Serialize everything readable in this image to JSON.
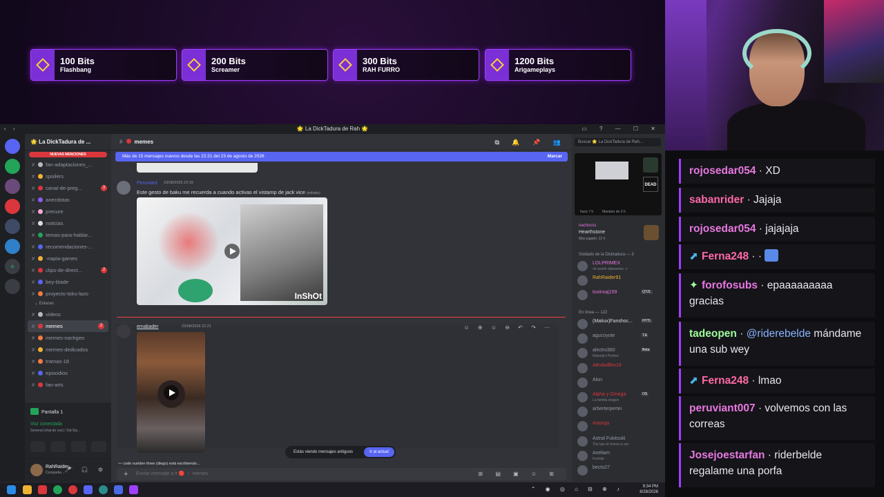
{
  "bits_goals": [
    {
      "amount": "100 Bits",
      "name": "Flashbang"
    },
    {
      "amount": "200 Bits",
      "name": "Screamer"
    },
    {
      "amount": "300 Bits",
      "name": "RAH FURRO"
    },
    {
      "amount": "1200 Bits",
      "name": "Arigameplays"
    }
  ],
  "discord": {
    "window_title": "🌟 La DickTadura de Rah 🌟",
    "server_name": "🌟 La DickTadura de ...",
    "mentions_pill": "NUEVAS MENCIONES",
    "channels": [
      {
        "name": "fan-adaptaciones_...",
        "color": "#b5bac1"
      },
      {
        "name": "spoilers",
        "color": "#f0b232"
      },
      {
        "name": "canal-de-preg...",
        "color": "#da373c",
        "badge": "3"
      },
      {
        "name": "anecdotas",
        "color": "#8a5cf6"
      },
      {
        "name": "precure",
        "color": "#f9a8d4"
      },
      {
        "name": "noticias",
        "color": "#dbdee1"
      },
      {
        "name": "temas-para-hablar...",
        "color": "#23a559"
      },
      {
        "name": "recomendaciones-...",
        "color": "#5865f2"
      },
      {
        "name": "-napia-games",
        "color": "#f0b232"
      },
      {
        "name": "clips-de-direct...",
        "color": "#da373c",
        "badge": "2"
      },
      {
        "name": "bey-blade",
        "color": "#5865f2"
      },
      {
        "name": "proyecto-toku-lazo",
        "color": "#f47b3f"
      }
    ],
    "category_label": "Enlaces",
    "channels2": [
      {
        "name": "videos",
        "color": "#b5bac1"
      },
      {
        "name": "memes",
        "color": "#da373c",
        "badge": "2",
        "active": true
      },
      {
        "name": "memes-nachgeo",
        "color": "#f47b3f"
      },
      {
        "name": "memes-dedicados",
        "color": "#f0b232"
      },
      {
        "name": "tramas-18",
        "color": "#f47b3f"
      },
      {
        "name": "episodios",
        "color": "#5865f2"
      },
      {
        "name": "fan-arts",
        "color": "#da373c"
      }
    ],
    "screen_share": "Pantalla 1",
    "voice_status": "Voz conectada",
    "voice_channel": "General (chat de voz) / Sid Sty...",
    "user_name": "RahRaider...",
    "user_status": "Compartie...",
    "channel_header": "memes",
    "new_messages_bar": "Más de 15 mensajes nuevos desde las 22:21 del 23 de agosto de 2026",
    "mark_as_read": "Marcar",
    "message1": {
      "author": "Peruviant",
      "timestamp": "23/08/2026 22:16",
      "text": "Este gesto de baku me recuerda a cuando activas el vistamp de jack vice",
      "edited": "(editado)",
      "watermark": "InShOt"
    },
    "message2": {
      "author": "emabader",
      "timestamp": "23/08/2026 22:21"
    },
    "old_messages_notice": "Estás viendo mensajes antiguos",
    "jump_button": "Ir al actual",
    "typing_text": "code number three (diego) está escribiendo...",
    "composer_placeholder": "Enviar mensaje a # 🔴 ・ memes",
    "search_placeholder": "Buscar 🌟 La DickTadura de Rah...",
    "activity": {
      "name": "nachocss",
      "game": "Hearthstone",
      "detail": "Más jugado: 12 h"
    },
    "stream_card": {
      "left": "hace 7 h",
      "right": "Maraton de 3 h"
    },
    "section_soldado": "Soldado de la Dicktadura — 3",
    "soldados": [
      {
        "name": "LOLPRIMEX",
        "sub": "oh yeahh diamantes :>",
        "color": "#e878e0"
      },
      {
        "name": "RahRaider91",
        "sub": "",
        "color": "#f0b232"
      },
      {
        "name": "toxinsaj159",
        "sub": "",
        "color": "#e878e0",
        "tag": "QTZL"
      }
    ],
    "section_online": "En línea — 122",
    "online": [
      {
        "name": "(Matiux)Fanshoc...",
        "sub": "",
        "color": "#dbdee1",
        "tag": "HYTL"
      },
      {
        "name": "agucoyote",
        "sub": "",
        "color": "#949ba4",
        "tag": "T.E"
      },
      {
        "name": "alectro360",
        "sub": "Nobody's Perfect",
        "color": "#949ba4",
        "tag": "Beta"
      },
      {
        "name": "Alexbolflex19",
        "sub": "",
        "color": "#da373c"
      },
      {
        "name": "Alon",
        "sub": "",
        "color": "#949ba4"
      },
      {
        "name": "Alpha y Omega",
        "sub": "La familia dragon",
        "color": "#da373c",
        "tag": "OS"
      },
      {
        "name": "arberterpertei",
        "sub": "",
        "color": "#949ba4"
      },
      {
        "name": "Astorga",
        "sub": "",
        "color": "#da373c"
      },
      {
        "name": "Astral Fukitsuki",
        "sub": "The law of victory is set",
        "color": "#949ba4"
      },
      {
        "name": "Axeliam",
        "sub": "Fortnite",
        "color": "#949ba4"
      },
      {
        "name": "becto27",
        "sub": "",
        "color": "#949ba4"
      }
    ]
  },
  "chat": [
    {
      "user": "rojosedar054",
      "text": "XD",
      "style": ""
    },
    {
      "user": "sabanrider",
      "text": "Jajaja",
      "style": "alt"
    },
    {
      "user": "rojosedar054",
      "text": "jajajaja",
      "style": ""
    },
    {
      "user": "Ferna248",
      "text": "·",
      "style": "alt",
      "icon": "twitch-prime-icon",
      "icon2": "emote-icon"
    },
    {
      "user": "forofosubs",
      "text": "epaaaaaaaaa gracias",
      "style": "",
      "icon": "sparkle-icon"
    },
    {
      "user": "tadeopen",
      "mention": "@riderebelde",
      "text": "mándame una sub wey",
      "style": "green"
    },
    {
      "user": "Ferna248",
      "text": "lmao",
      "style": "alt",
      "icon": "twitch-prime-icon"
    },
    {
      "user": "peruviant007",
      "text": "volvemos con las correas",
      "style": ""
    },
    {
      "user": "Josejoestarfan",
      "text": "riderbelde regalame una porfa",
      "style": ""
    }
  ],
  "taskbar": {
    "time": "9:34 PM",
    "date": "8/28/2026"
  }
}
